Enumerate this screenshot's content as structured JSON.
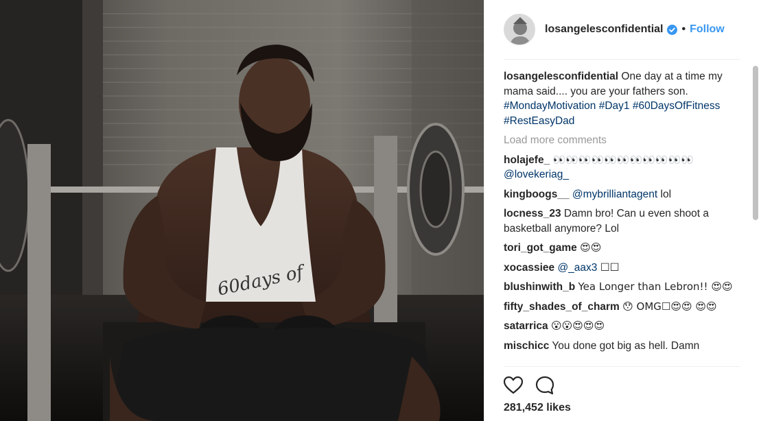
{
  "header": {
    "username": "losangelesconfidential",
    "separator": "•",
    "follow_label": "Follow"
  },
  "caption": {
    "username": "losangelesconfidential",
    "text": "One day at a time my mama said.... you are your fathers son.",
    "hashtags": [
      "#MondayMotivation",
      "#Day1",
      "#60DaysOfFitness",
      "#RestEasyDad"
    ]
  },
  "load_more_label": "Load more comments",
  "comments": [
    {
      "username": "holajefe_",
      "text": "👀👀👀👀👀👀👀👀👀👀👀",
      "mention": "@lovekeriag_"
    },
    {
      "username": "kingboogs__",
      "mention": "@mybrilliantagent",
      "text": "lol"
    },
    {
      "username": "locness_23",
      "text": "Damn bro! Can u even shoot a basketball anymore? Lol"
    },
    {
      "username": "tori_got_game",
      "text": "😍😍"
    },
    {
      "username": "xocassiee",
      "mention": "@_aax3",
      "text": "☐☐"
    },
    {
      "username": "blushinwith_b",
      "text": "Yea Longer than Lebron!! 😍😍"
    },
    {
      "username": "fifty_shades_of_charm",
      "text": "😯 OMG☐😍😍 😍😍"
    },
    {
      "username": "satarrica",
      "text": "😮😮😍😍😍"
    },
    {
      "username": "mischicc",
      "text": "You done got big as hell. Damn"
    }
  ],
  "likes": "281,452 likes",
  "icons": {
    "like": "heart-icon",
    "comment": "comment-bubble-icon",
    "verified": "verified-badge-icon"
  },
  "colors": {
    "accent": "#3897f0",
    "hashtag": "#003569",
    "muted": "#999999",
    "text": "#262626"
  }
}
